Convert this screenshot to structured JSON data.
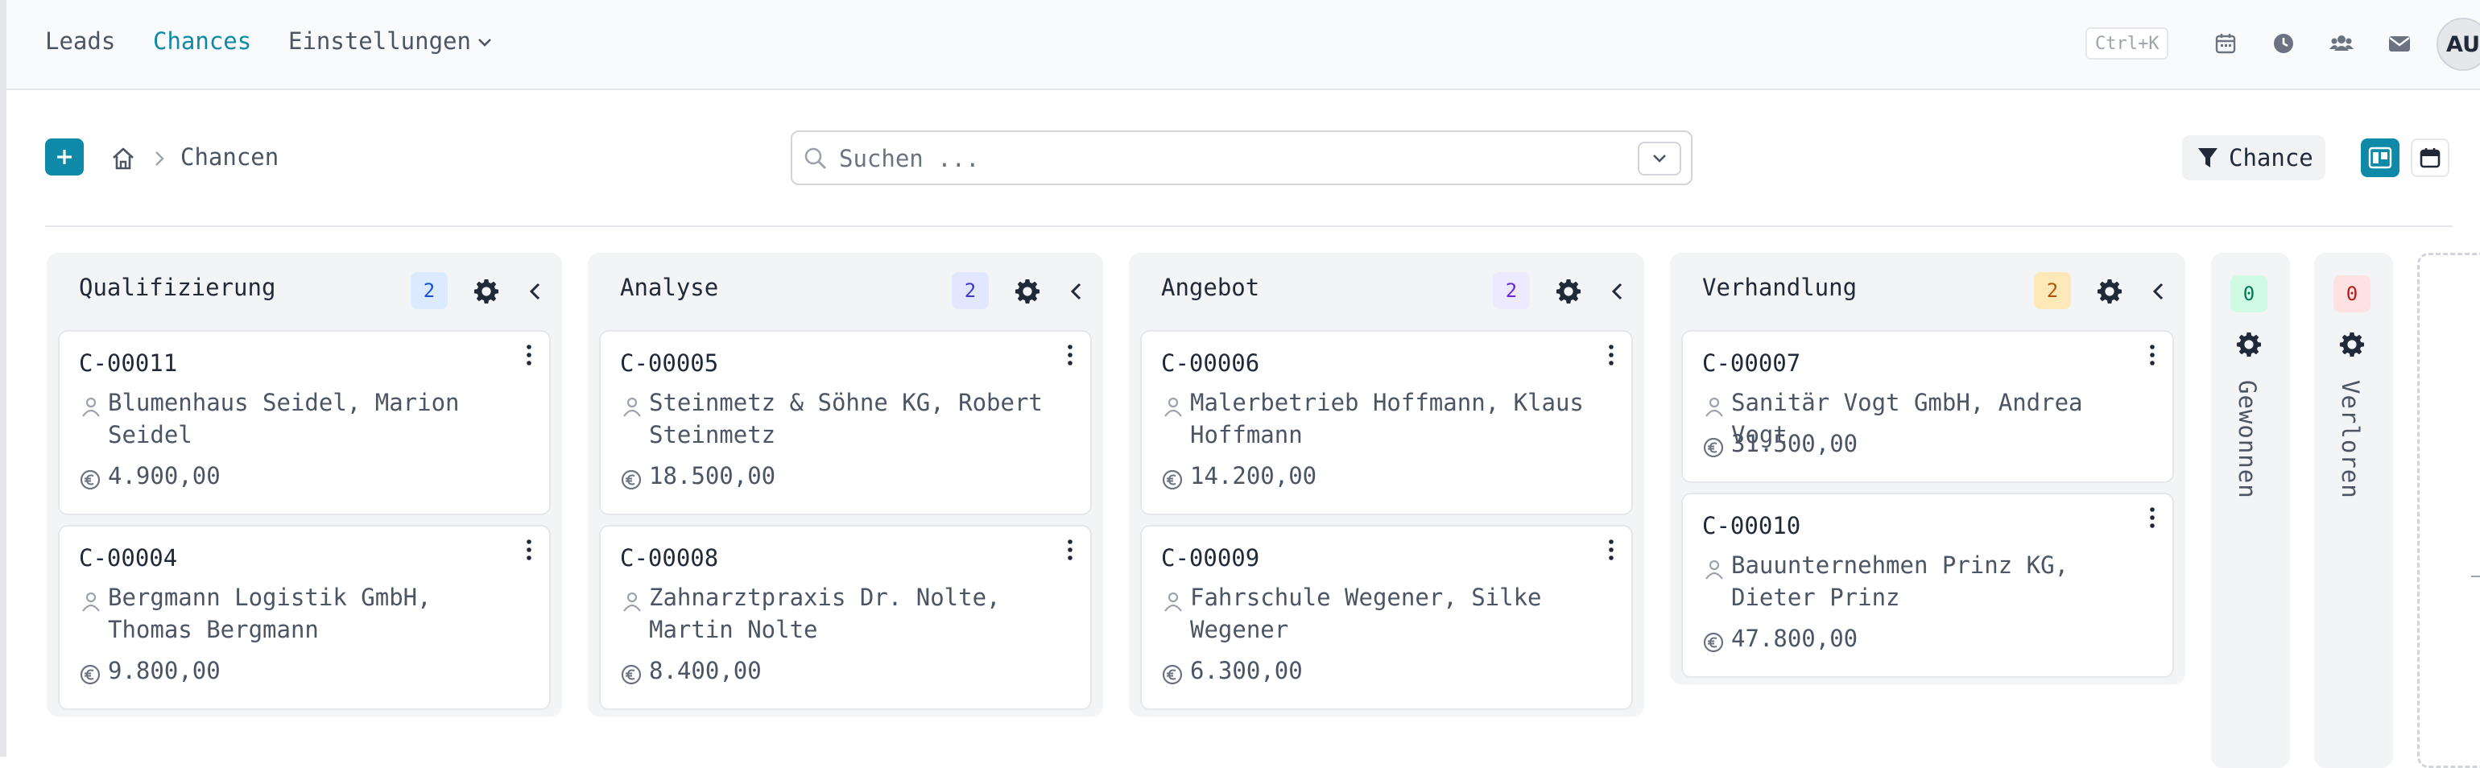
{
  "nav": {
    "items": [
      {
        "label": "Leads"
      },
      {
        "label": "Chances"
      },
      {
        "label": "Einstellungen"
      }
    ],
    "shortcut": "Ctrl+K",
    "avatar": "AU"
  },
  "icons": [
    "calendar-icon",
    "clock-icon",
    "users-icon",
    "mail-icon",
    "home-icon",
    "search-icon",
    "filter-icon",
    "kanban-view-icon",
    "calendar-view-icon",
    "gear-icon",
    "user-icon",
    "euro-icon",
    "kebab-icon"
  ],
  "colors": {
    "accent": "#0e8aa8"
  },
  "breadcrumb": {
    "current": "Chancen"
  },
  "search": {
    "placeholder": "Suchen ..."
  },
  "filter": {
    "label": "Chance"
  },
  "columns": [
    {
      "title": "Qualifizierung",
      "count": "2",
      "cards": [
        {
          "id": "C-00011",
          "contact": "Blumenhaus Seidel, Marion Seidel",
          "amount": "4.900,00"
        },
        {
          "id": "C-00004",
          "contact": "Bergmann Logistik GmbH, Thomas Bergmann",
          "amount": "9.800,00"
        }
      ]
    },
    {
      "title": "Analyse",
      "count": "2",
      "cards": [
        {
          "id": "C-00005",
          "contact": "Steinmetz & Söhne KG, Robert Steinmetz",
          "amount": "18.500,00"
        },
        {
          "id": "C-00008",
          "contact": "Zahnarztpraxis Dr. Nolte, Martin Nolte",
          "amount": "8.400,00"
        }
      ]
    },
    {
      "title": "Angebot",
      "count": "2",
      "cards": [
        {
          "id": "C-00006",
          "contact": "Malerbetrieb Hoffmann, Klaus Hoffmann",
          "amount": "14.200,00"
        },
        {
          "id": "C-00009",
          "contact": "Fahrschule Wegener, Silke Wegener",
          "amount": "6.300,00"
        }
      ]
    },
    {
      "title": "Verhandlung",
      "count": "2",
      "cards": [
        {
          "id": "C-00007",
          "contact": "Sanitär Vogt GmbH, Andrea Vogt",
          "amount": "31.500,00"
        },
        {
          "id": "C-00010",
          "contact": "Bauunternehmen Prinz KG, Dieter Prinz",
          "amount": "47.800,00"
        }
      ]
    }
  ],
  "collapsed": [
    {
      "title": "Gewonnen",
      "count": "0"
    },
    {
      "title": "Verloren",
      "count": "0"
    }
  ]
}
